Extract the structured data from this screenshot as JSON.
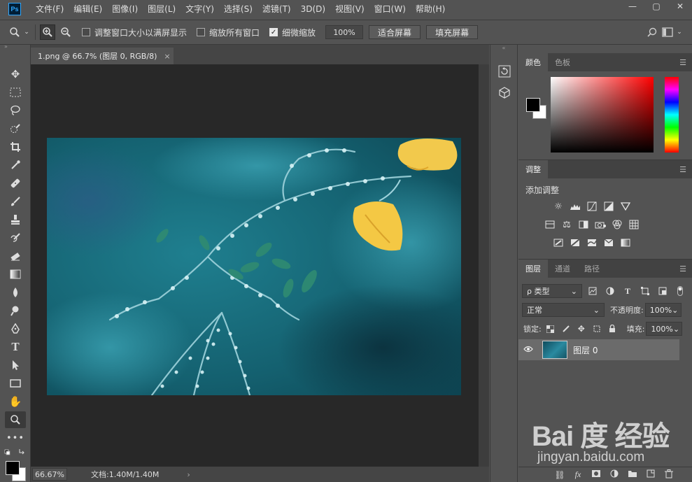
{
  "app": {
    "logo_text": "Ps"
  },
  "menu": [
    "文件(F)",
    "编辑(E)",
    "图像(I)",
    "图层(L)",
    "文字(Y)",
    "选择(S)",
    "滤镜(T)",
    "3D(D)",
    "视图(V)",
    "窗口(W)",
    "帮助(H)"
  ],
  "window_controls": {
    "minimize": "—",
    "maximize": "▢",
    "close": "✕"
  },
  "options": {
    "resize_windows": "调整窗口大小以满屏显示",
    "zoom_all": "缩放所有窗口",
    "scrubby_zoom": "细微缩放",
    "scrubby_checked": true,
    "zoom_value": "100%",
    "fit_screen": "适合屏幕",
    "fill_screen": "填充屏幕"
  },
  "document": {
    "tab_title": "1.png @ 66.7% (图层 0, RGB/8)",
    "tab_close": "×",
    "zoom": "66.67%",
    "doc_info": "文档:1.40M/1.40M",
    "status_arrow": "›"
  },
  "color_panel": {
    "tabs": [
      "颜色",
      "色板"
    ],
    "fg_color": "#000000",
    "bg_color": "#ffffff"
  },
  "adjust_panel": {
    "tab": "调整",
    "label": "添加调整"
  },
  "layers_panel": {
    "tabs": [
      "图层",
      "通道",
      "路径"
    ],
    "filter_kind": "ρ 类型",
    "blend_mode": "正常",
    "opacity_label": "不透明度:",
    "opacity_value": "100%",
    "lock_label": "锁定:",
    "fill_label": "填充:",
    "fill_value": "100%",
    "layers": [
      {
        "name": "图层 0",
        "visible": true
      }
    ]
  },
  "watermark": {
    "brand": "Bai 度 经验",
    "url": "jingyan.baidu.com"
  },
  "colors": {
    "ui_bg": "#535353",
    "canvas_bg": "#282828",
    "panel_dark": "#424242",
    "ps_blue": "#31a8ff"
  }
}
